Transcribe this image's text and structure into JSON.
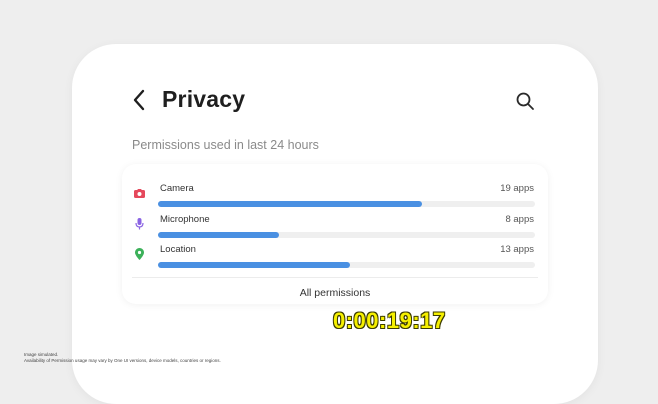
{
  "header": {
    "title": "Privacy"
  },
  "section": {
    "label": "Permissions used in last 24 hours"
  },
  "permissions": [
    {
      "label": "Camera",
      "count": "19 apps",
      "icon": "camera-icon",
      "usage_fraction": 0.7,
      "icon_color": "#e5485c"
    },
    {
      "label": "Microphone",
      "count": "8 apps",
      "icon": "microphone-icon",
      "usage_fraction": 0.32,
      "icon_color": "#8a63e3"
    },
    {
      "label": "Location",
      "count": "13 apps",
      "icon": "location-icon",
      "usage_fraction": 0.51,
      "icon_color": "#3cb15a"
    }
  ],
  "all_permissions_label": "All permissions",
  "timecode": "0:00:19:17",
  "disclaimer": {
    "line1": "Image simulated.",
    "line2": "Availability of Permission usage may vary by One UI versions, device models, countries or regions."
  },
  "colors": {
    "bar": "#4a90e2",
    "track": "#efefef",
    "title": "#1f1f1f",
    "timecode": "#f6f000"
  }
}
